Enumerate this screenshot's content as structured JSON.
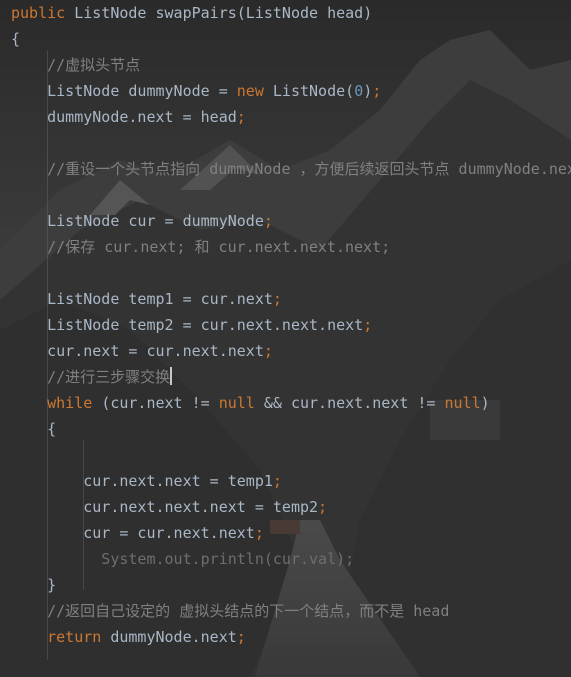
{
  "editor": {
    "lines": [
      {
        "segments": [
          {
            "t": "public ",
            "c": "kw"
          },
          {
            "t": "ListNode swapPairs(ListNode head)",
            "c": "plain"
          }
        ]
      },
      {
        "segments": [
          {
            "t": "{",
            "c": "plain"
          }
        ]
      },
      {
        "segments": [
          {
            "t": "    //虚拟头节点",
            "c": "comment"
          }
        ]
      },
      {
        "segments": [
          {
            "t": "    ListNode dummyNode = ",
            "c": "plain"
          },
          {
            "t": "new ",
            "c": "kw"
          },
          {
            "t": "ListNode(",
            "c": "plain"
          },
          {
            "t": "0",
            "c": "num"
          },
          {
            "t": ")",
            "c": "plain"
          },
          {
            "t": ";",
            "c": "semi"
          }
        ]
      },
      {
        "segments": [
          {
            "t": "    dummyNode.next = head",
            "c": "plain"
          },
          {
            "t": ";",
            "c": "semi"
          }
        ]
      },
      {
        "segments": []
      },
      {
        "segments": [
          {
            "t": "    //重设一个头节点指向 dummyNode ，方便后续返回头节点 dummyNode.next",
            "c": "comment"
          }
        ]
      },
      {
        "segments": []
      },
      {
        "segments": [
          {
            "t": "    ListNode cur = dummyNode",
            "c": "plain"
          },
          {
            "t": ";",
            "c": "semi"
          }
        ]
      },
      {
        "segments": [
          {
            "t": "    //保存 cur.next; 和 cur.next.next.next;",
            "c": "comment"
          }
        ]
      },
      {
        "segments": []
      },
      {
        "segments": [
          {
            "t": "    ListNode temp1 = cur.next",
            "c": "plain"
          },
          {
            "t": ";",
            "c": "semi"
          }
        ]
      },
      {
        "segments": [
          {
            "t": "    ListNode temp2 = cur.next.next.next",
            "c": "plain"
          },
          {
            "t": ";",
            "c": "semi"
          }
        ]
      },
      {
        "segments": [
          {
            "t": "    cur.next = cur.next.next",
            "c": "plain"
          },
          {
            "t": ";",
            "c": "semi"
          }
        ]
      },
      {
        "segments": [
          {
            "t": "    //进行三步骤交换",
            "c": "comment"
          }
        ],
        "caret": true
      },
      {
        "segments": [
          {
            "t": "    ",
            "c": "plain"
          },
          {
            "t": "while ",
            "c": "kw"
          },
          {
            "t": "(cur.next != ",
            "c": "plain"
          },
          {
            "t": "null ",
            "c": "kw"
          },
          {
            "t": "&& cur.next.next != ",
            "c": "plain"
          },
          {
            "t": "null",
            "c": "kw"
          },
          {
            "t": ")",
            "c": "plain"
          }
        ]
      },
      {
        "segments": [
          {
            "t": "    {",
            "c": "plain"
          }
        ]
      },
      {
        "segments": []
      },
      {
        "segments": [
          {
            "t": "        cur.next.next = temp1",
            "c": "plain"
          },
          {
            "t": ";",
            "c": "semi"
          }
        ]
      },
      {
        "segments": [
          {
            "t": "        cur.next.next.next = temp2",
            "c": "plain"
          },
          {
            "t": ";",
            "c": "semi"
          }
        ]
      },
      {
        "segments": [
          {
            "t": "        cur = cur.next.next",
            "c": "plain"
          },
          {
            "t": ";",
            "c": "semi"
          }
        ]
      },
      {
        "segments": [
          {
            "t": "          System.out.println(cur.val);",
            "c": "dim"
          }
        ]
      },
      {
        "segments": [
          {
            "t": "    }",
            "c": "plain"
          }
        ]
      },
      {
        "segments": [
          {
            "t": "    //返回自己设定的 虚拟头结点的下一个结点，而不是 head",
            "c": "comment"
          }
        ]
      },
      {
        "segments": [
          {
            "t": "    ",
            "c": "plain"
          },
          {
            "t": "return ",
            "c": "kw"
          },
          {
            "t": "dummyNode.next",
            "c": "plain"
          },
          {
            "t": ";",
            "c": "semi"
          }
        ]
      },
      {
        "segments": []
      },
      {
        "segments": [
          {
            "t": "}",
            "c": "plain"
          }
        ]
      }
    ]
  },
  "colors": {
    "background": "#2b2b2b",
    "keyword": "#cc7832",
    "plain": "#a9b7c6",
    "comment": "#808080",
    "number": "#6897bb"
  }
}
